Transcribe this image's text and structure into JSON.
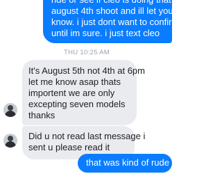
{
  "conversation": {
    "top_sent_message": {
      "lines": [
        "ride or see if cleo is doing that",
        "august 4th shoot and ill let you",
        "know. i just dont want to confirm",
        "until im sure. i just text cleo"
      ]
    },
    "timestamp": "THU 10:25 AM",
    "received_message_1": {
      "lines": [
        "It's August 5th not 4th at 6pm",
        "let me know asap thats",
        "importent we are only",
        "excepting seven models",
        "thanks"
      ]
    },
    "received_message_2": {
      "lines": [
        "Did u not read last message i",
        "sent u please read it"
      ]
    },
    "bottom_sent_message": {
      "text": "that was kind of rude"
    },
    "colors": {
      "sent_bubble": "#0a7cff",
      "received_bubble": "#e9ebee",
      "timestamp_text": "#9ea2a8"
    }
  }
}
